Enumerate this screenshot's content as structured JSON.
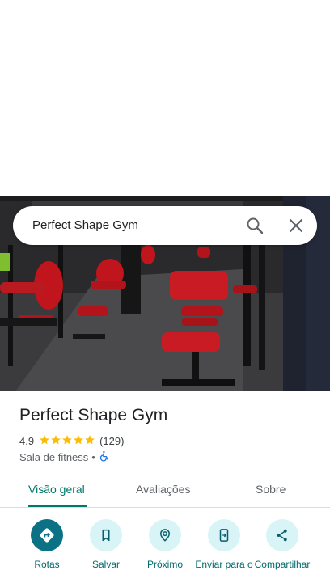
{
  "search": {
    "query": "Perfect Shape Gym"
  },
  "place": {
    "title": "Perfect Shape Gym",
    "rating": "4,9",
    "stars": 5,
    "reviews": "(129)",
    "category": "Sala de fitness",
    "separator": "•",
    "accessibility_icon": "wheelchair-icon"
  },
  "tabs": [
    {
      "label": "Visão geral",
      "active": true
    },
    {
      "label": "Avaliações",
      "active": false
    },
    {
      "label": "Sobre",
      "active": false
    }
  ],
  "actions": [
    {
      "label": "Rotas",
      "icon": "directions-icon"
    },
    {
      "label": "Salvar",
      "icon": "bookmark-icon"
    },
    {
      "label": "Próximo",
      "icon": "nearby-icon"
    },
    {
      "label": "Enviar para o",
      "icon": "send-to-phone-icon"
    },
    {
      "label": "Compartilhar",
      "icon": "share-icon"
    }
  ],
  "colors": {
    "accent": "#00796b",
    "star": "#fbbc04",
    "action_bg": "#d8f4f7",
    "primary_action": "#0b7285",
    "accessibility": "#1a73e8"
  }
}
